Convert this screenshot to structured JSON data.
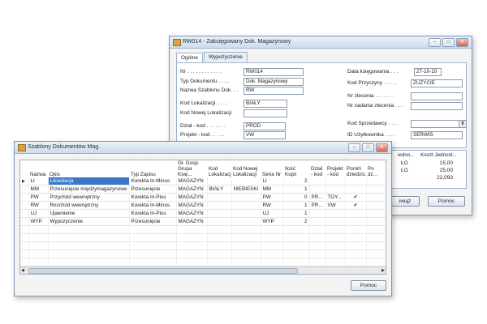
{
  "back_window": {
    "title": "RW014 - Zaksięgowany Dok. Magazynowy",
    "tabs": [
      "Ogólne",
      "Wypożyczenie"
    ],
    "left_fields": [
      {
        "label": "Nr . . . . . . . . . . . .",
        "value": "RW014"
      },
      {
        "label": "Typ Dokumentu . . . .",
        "value": "Dok. Magazynowy"
      },
      {
        "label": "Nazwa Szablonu Dok. . .",
        "value": "RW"
      },
      {
        "label": "Kod Lokalizacji. . . . .",
        "value": "BIAŁY"
      },
      {
        "label": "Kod Nowej Lokalizacji",
        "value": ""
      },
      {
        "label": "Dział - kod . . . . . . .",
        "value": "PROD"
      },
      {
        "label": "Projekt - kod . . . . .",
        "value": "VW"
      }
    ],
    "right_fields": [
      {
        "label": "Data księgowania . . .",
        "value": "27-10-10"
      },
      {
        "label": "Kod Przyczyny . . . . .",
        "value": "ZUŻYCIE"
      },
      {
        "label": "Nr zlecenia . . . . . . .",
        "value": ""
      },
      {
        "label": "Nr zadania zlecenia . . .",
        "value": ""
      },
      {
        "label": "Kod Sprzedawcy . . . .",
        "value": ""
      },
      {
        "label": "ID Użytkownika . . . .",
        "value": "SERWIS"
      }
    ],
    "lines_header": [
      "iedno...",
      "Koszt Jednost..."
    ],
    "lines": [
      {
        "a": "ŁO",
        "b": "15,00"
      },
      {
        "a": "ŁO",
        "b": "25,00"
      },
      {
        "a": "",
        "b": "22,093"
      }
    ],
    "buttons": {
      "partial": "iwiąż",
      "help": "Pomoc"
    }
  },
  "front_window": {
    "title": "Szablony Dokumentów Mag.",
    "columns": [
      "Nazwa",
      "Opis",
      "Typ Zapisu",
      "Gł. Gosp. Grupa Księ...",
      "Kod Lokalizacji",
      "Kod Nowej Lokalizacji",
      "Seria Nr",
      "Ilość Kopii",
      "Dział - kod",
      "Projekt - kod",
      "Pomiń dziedzic...",
      "Po dz..."
    ],
    "rows": [
      {
        "nazwa": "LI",
        "opis": "Likwidacja",
        "typ": "Korekta In-Minus",
        "grupa": "MAGAZYN",
        "lok": "",
        "nowa": "",
        "seria": "LI",
        "kopie": "2",
        "dzial": "",
        "projekt": "",
        "pomin": ""
      },
      {
        "nazwa": "MM",
        "opis": "Przesunięcie międzymagazynowe",
        "typ": "Przesunięcie",
        "grupa": "MAGAZYN",
        "lok": "BIAŁY",
        "nowa": "NIEBIESKI",
        "seria": "MM",
        "kopie": "1",
        "dzial": "",
        "projekt": "",
        "pomin": ""
      },
      {
        "nazwa": "PW",
        "opis": "Przychód wewnętrzny",
        "typ": "Korekta In-Plus",
        "grupa": "MAGAZYN",
        "lok": "",
        "nowa": "",
        "seria": "PW",
        "kopie": "0",
        "dzial": "PR...",
        "projekt": "TOY...",
        "pomin": "✔"
      },
      {
        "nazwa": "RW",
        "opis": "Rozchód wewnętrzny",
        "typ": "Korekta In-Minus",
        "grupa": "MAGAZYN",
        "lok": "",
        "nowa": "",
        "seria": "RW",
        "kopie": "1",
        "dzial": "PR...",
        "projekt": "VW",
        "pomin": "✔"
      },
      {
        "nazwa": "UJ",
        "opis": "Ujawnienie",
        "typ": "Korekta In-Plus",
        "grupa": "MAGAZYN",
        "lok": "",
        "nowa": "",
        "seria": "UJ",
        "kopie": "1",
        "dzial": "",
        "projekt": "",
        "pomin": ""
      },
      {
        "nazwa": "WYP",
        "opis": "Wypożyczenie",
        "typ": "Przesunięcie",
        "grupa": "MAGAZYN",
        "lok": "",
        "nowa": "",
        "seria": "WYP",
        "kopie": "2",
        "dzial": "",
        "projekt": "",
        "pomin": ""
      }
    ],
    "empty_rows": 7,
    "buttons": {
      "help": "Pomoc"
    }
  }
}
